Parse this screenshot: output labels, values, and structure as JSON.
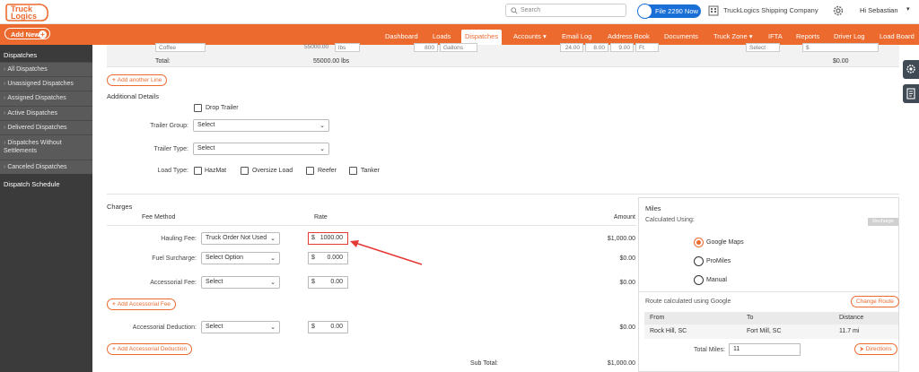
{
  "header": {
    "logo_text_1": "Truck",
    "logo_text_2": "Logics",
    "search_placeholder": "Search",
    "file_button": "File 2290 Now",
    "company": "TruckLogics Shipping Company",
    "greeting": "Hi Sebastian"
  },
  "nav": {
    "add_new": "Add New",
    "items": [
      "Dashboard",
      "Loads",
      "Dispatches",
      "Accounts",
      "Email Log",
      "Address Book",
      "Documents",
      "Truck Zone",
      "IFTA",
      "Reports",
      "Driver Log",
      "Load Board"
    ],
    "active": "Dispatches"
  },
  "sidebar": {
    "section": "Dispatches",
    "items": [
      "All Dispatches",
      "Unassigned Dispatches",
      "Assigned Dispatches",
      "Active Dispatches",
      "Delivered Dispatches",
      "Dispatches Without Settlements",
      "Canceled Dispatches"
    ],
    "schedule": "Dispatch Schedule"
  },
  "line_row": {
    "commodity": "Coffee",
    "weight": "55000.00",
    "weight_unit": "lbs",
    "qty": "800",
    "qty_unit": "Gallons",
    "dim1": "24.00",
    "dim2": "8.00",
    "dim3": "9.00",
    "dim_unit": "Ft",
    "select": "Select",
    "currency": "$",
    "total_label": "Total:",
    "total_weight": "55000.00 lbs",
    "total_amount": "$0.00",
    "add_line": "Add another Line"
  },
  "additional": {
    "title": "Additional Details",
    "drop_trailer": "Drop Trailer",
    "trailer_group_label": "Trailer Group:",
    "trailer_group_value": "Select",
    "trailer_type_label": "Trailer Type:",
    "trailer_type_value": "Select",
    "load_type_label": "Load Type:",
    "load_types": [
      "HazMat",
      "Oversize Load",
      "Reefer",
      "Tanker"
    ]
  },
  "charges": {
    "title": "Charges",
    "col_fee_method": "Fee Method",
    "col_rate": "Rate",
    "col_amount": "Amount",
    "hauling_label": "Hauling Fee:",
    "hauling_method": "Truck Order Not Used",
    "hauling_rate": "1000.00",
    "hauling_amount": "$1,000.00",
    "fuel_label": "Fuel Surcharge:",
    "fuel_method": "Select Option",
    "fuel_rate": "0.000",
    "fuel_amount": "$0.00",
    "accessorial_label": "Accessorial Fee:",
    "accessorial_method": "Select",
    "accessorial_rate": "0.00",
    "accessorial_amount": "$0.00",
    "add_accessorial": "Add Accessorial Fee",
    "deduction_label": "Accessorial Deduction:",
    "deduction_method": "Select",
    "deduction_rate": "0.00",
    "deduction_amount": "$0.00",
    "add_deduction": "Add Accessorial Deduction",
    "currency": "$",
    "subtotal_label": "Sub Total:",
    "subtotal_amount": "$1,000.00"
  },
  "miles": {
    "title": "Miles",
    "calc_label": "Calculated Using:",
    "recharge": "Recharge",
    "options": [
      "Google Maps",
      "ProMiles",
      "Manual"
    ],
    "selected": "Google Maps",
    "route_note": "Route calculated using Google",
    "change_route": "Change Route",
    "col_from": "From",
    "col_to": "To",
    "col_distance": "Distance",
    "from": "Rock Hill, SC",
    "to": "Fort Mill, SC",
    "distance": "11.7 mi",
    "total_label": "Total Miles:",
    "total_value": "11",
    "directions": "Directions"
  },
  "colors": {
    "brand": "#ec6a2e",
    "sidebar": "#3b3b3b",
    "highlight": "#e53935",
    "file_button": "#1a6fd6"
  }
}
